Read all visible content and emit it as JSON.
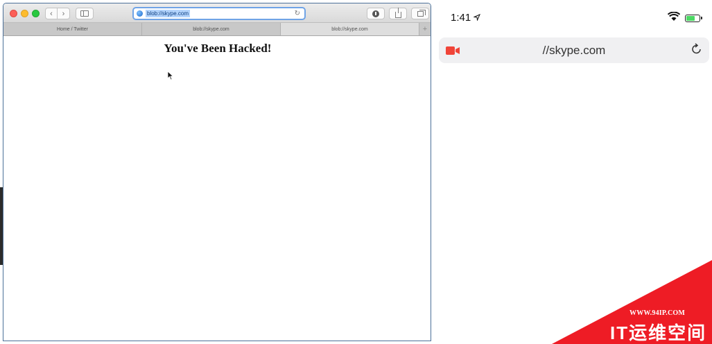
{
  "mac": {
    "address_url": "blob://skype.com",
    "tabs": [
      {
        "label": "Home / Twitter"
      },
      {
        "label": "blob://skype.com"
      },
      {
        "label": "blob://skype.com"
      }
    ],
    "add_tab": "+",
    "page_heading": "You've Been Hacked!"
  },
  "ios": {
    "time": "1:41",
    "url": "//skype.com",
    "battery_level": 0.7
  },
  "watermark": {
    "url": "WWW.94IP.COM",
    "title": "IT运维空间"
  },
  "colors": {
    "address_focus": "#6fa3e6",
    "camera_red": "#f04438",
    "watermark_red": "#ee1c25"
  },
  "icons": [
    "back-icon",
    "forward-icon",
    "sidebar-icon",
    "globe-icon",
    "reload-icon",
    "download-icon",
    "share-icon",
    "tabs-icon",
    "location-arrow-icon",
    "wifi-icon",
    "battery-icon",
    "video-camera-icon"
  ]
}
